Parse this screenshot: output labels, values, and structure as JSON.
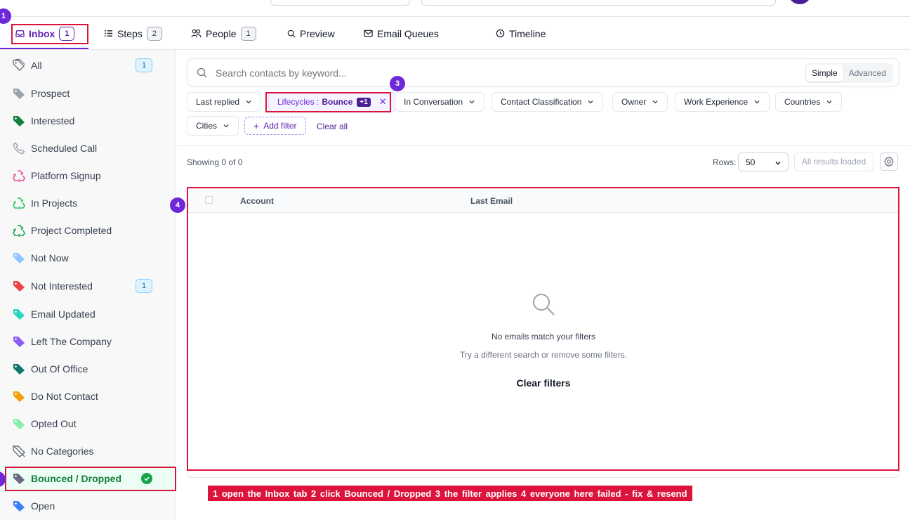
{
  "tabs": [
    {
      "label": "Inbox",
      "count": "1",
      "icon": "inbox-icon"
    },
    {
      "label": "Steps",
      "count": "2",
      "icon": "list-icon"
    },
    {
      "label": "People",
      "count": "1",
      "icon": "people-icon"
    },
    {
      "label": "Preview",
      "icon": "search-icon"
    },
    {
      "label": "Email Queues",
      "icon": "mail-icon"
    },
    {
      "label": "Timeline",
      "icon": "history-icon"
    }
  ],
  "sidebar": {
    "items": [
      {
        "label": "All",
        "count": "1",
        "color": "#9ca3af",
        "icon": "tags-icon"
      },
      {
        "label": "Prospect",
        "color": "#9ca3af",
        "icon": "tag-icon"
      },
      {
        "label": "Interested",
        "color": "#15803d",
        "icon": "tag-icon"
      },
      {
        "label": "Scheduled Call",
        "color": "#9ca3af",
        "icon": "phone-icon"
      },
      {
        "label": "Platform Signup",
        "color": "#ec4899",
        "icon": "recycle-icon"
      },
      {
        "label": "In Projects",
        "color": "#22c55e",
        "icon": "recycle-icon"
      },
      {
        "label": "Project Completed",
        "color": "#16a34a",
        "icon": "recycle-icon"
      },
      {
        "label": "Not Now",
        "color": "#93c5fd",
        "icon": "tag-icon"
      },
      {
        "label": "Not Interested",
        "count": "1",
        "color": "#ef4444",
        "icon": "tag-icon"
      },
      {
        "label": "Email Updated",
        "color": "#2dd4bf",
        "icon": "tag-icon"
      },
      {
        "label": "Left The Company",
        "color": "#8b5cf6",
        "icon": "tag-icon"
      },
      {
        "label": "Out Of Office",
        "color": "#0f766e",
        "icon": "tag-icon"
      },
      {
        "label": "Do Not Contact",
        "color": "#f59e0b",
        "icon": "tag-icon"
      },
      {
        "label": "Opted Out",
        "color": "#86efac",
        "icon": "tag-icon"
      },
      {
        "label": "No Categories",
        "color": "#6b7280",
        "icon": "tag-off-icon"
      },
      {
        "label": "Bounced / Dropped",
        "color": "#6b6b80",
        "icon": "tag-icon",
        "selected": true
      },
      {
        "label": "Open",
        "color": "#3b82f6",
        "icon": "tag-icon"
      }
    ]
  },
  "search": {
    "placeholder": "Search contacts by keyword...",
    "mode_simple": "Simple",
    "mode_advanced": "Advanced"
  },
  "filters": {
    "last_replied": "Last replied",
    "lifecycles_prefix": "Lifecycles :",
    "lifecycles_value": "Bounce",
    "lifecycles_extra": "+1",
    "in_conversation": "In Conversation",
    "contact_classification": "Contact Classification",
    "owner": "Owner",
    "work_experience": "Work Experience",
    "countries": "Countries",
    "cities": "Cities",
    "add_filter": "Add filter",
    "clear_all": "Clear all"
  },
  "results": {
    "showing": "Showing 0 of 0",
    "rows_label": "Rows:",
    "rows_value": "50",
    "all_loaded": "All results loaded"
  },
  "table": {
    "columns": [
      "Account",
      "Last Email"
    ],
    "empty_title": "No emails match your filters",
    "empty_sub": "Try a different search or remove some filters.",
    "clear_filters": "Clear filters"
  },
  "annotations": {
    "markers": [
      "1",
      "3",
      "4"
    ],
    "caption": "1 open the Inbox tab   2 click Bounced / Dropped   3 the filter applies   4 everyone here failed - fix & resend",
    "highlight_color": "#dc143c"
  }
}
